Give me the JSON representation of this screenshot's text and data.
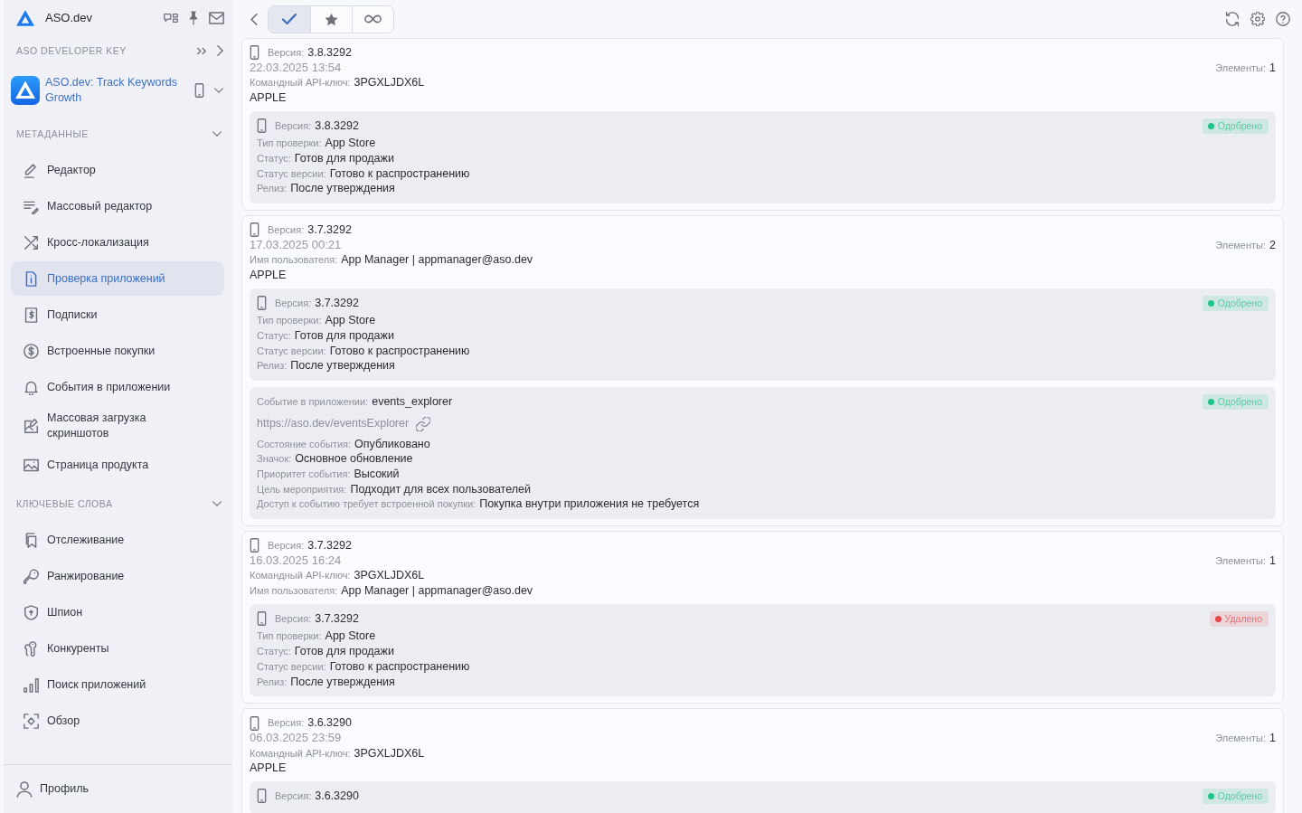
{
  "sidebar": {
    "brand": "ASO.dev",
    "developer_key": {
      "title": "ASO DEVELOPER KEY"
    },
    "app": {
      "name": "ASO.dev: Track Keywords Growth"
    },
    "sections": [
      {
        "title": "МЕТАДАННЫЕ",
        "expanded": true,
        "items": [
          {
            "label": "Редактор",
            "selected": false
          },
          {
            "label": "Массовый редактор",
            "selected": false
          },
          {
            "label": "Кросс-локализация",
            "selected": false
          },
          {
            "label": "Проверка приложений",
            "selected": true
          },
          {
            "label": "Подписки",
            "selected": false
          },
          {
            "label": "Встроенные покупки",
            "selected": false
          },
          {
            "label": "События в приложении",
            "selected": false
          },
          {
            "label": "Массовая загрузка скриншотов",
            "selected": false
          },
          {
            "label": "Страница продукта",
            "selected": false
          }
        ]
      },
      {
        "title": "КЛЮЧЕВЫЕ СЛОВА",
        "expanded": true,
        "items": [
          {
            "label": "Отслеживание",
            "selected": false
          },
          {
            "label": "Ранжирование",
            "selected": false
          },
          {
            "label": "Шпион",
            "selected": false
          },
          {
            "label": "Конкуренты",
            "selected": false
          },
          {
            "label": "Поиск приложений",
            "selected": false
          },
          {
            "label": "Обзор",
            "selected": false
          }
        ]
      }
    ],
    "profile": {
      "label": "Профиль"
    }
  },
  "toolbar": {
    "filters": [
      {
        "selected": true
      },
      {
        "selected": false
      },
      {
        "selected": false
      }
    ]
  },
  "submissions": [
    {
      "fields": [
        {
          "kind": "version",
          "label": "Версия:",
          "value": "3.8.3292"
        },
        {
          "kind": "date",
          "value": "22.03.2025 13:54"
        },
        {
          "kind": "field",
          "label": "Командный API-ключ:",
          "value": "3PGXLJDX6L"
        },
        {
          "kind": "plain",
          "value": "APPLE"
        }
      ],
      "count_label": "Элементы:",
      "count": "1",
      "items": [
        {
          "status": "Одобрено",
          "color": "#1fc48a",
          "fields": [
            {
              "kind": "version",
              "label": "Версия:",
              "value": "3.8.3292"
            },
            {
              "kind": "field",
              "label": "Тип проверки:",
              "value": "App Store"
            },
            {
              "kind": "field",
              "label": "Статус:",
              "value": "Готов для продажи"
            },
            {
              "kind": "field",
              "label": "Статус версии:",
              "value": "Готово к распространению"
            },
            {
              "kind": "field",
              "label": "Релиз:",
              "value": "После утверждения"
            }
          ]
        }
      ]
    },
    {
      "fields": [
        {
          "kind": "version",
          "label": "Версия:",
          "value": "3.7.3292"
        },
        {
          "kind": "date",
          "value": "17.03.2025 00:21"
        },
        {
          "kind": "field",
          "label": "Имя пользователя:",
          "value": "App Manager | appmanager@aso.dev"
        },
        {
          "kind": "plain",
          "value": "APPLE"
        }
      ],
      "count_label": "Элементы:",
      "count": "2",
      "items": [
        {
          "status": "Одобрено",
          "color": "#1fc48a",
          "fields": [
            {
              "kind": "version",
              "label": "Версия:",
              "value": "3.7.3292"
            },
            {
              "kind": "field",
              "label": "Тип проверки:",
              "value": "App Store"
            },
            {
              "kind": "field",
              "label": "Статус:",
              "value": "Готов для продажи"
            },
            {
              "kind": "field",
              "label": "Статус версии:",
              "value": "Готово к распространению"
            },
            {
              "kind": "field",
              "label": "Релиз:",
              "value": "После утверждения"
            }
          ]
        },
        {
          "status": "Одобрено",
          "color": "#1fc48a",
          "fields": [
            {
              "kind": "field",
              "label": "Событие в приложении:",
              "value": "events_explorer"
            },
            {
              "kind": "link",
              "value": "https://aso.dev/eventsExplorer"
            },
            {
              "kind": "field",
              "label": "Состояние события:",
              "value": "Опубликовано"
            },
            {
              "kind": "field",
              "label": "Значок:",
              "value": "Основное обновление"
            },
            {
              "kind": "field",
              "label": "Приоритет события:",
              "value": "Высокий"
            },
            {
              "kind": "field",
              "label": "Цель мероприятия:",
              "value": "Подходит для всех пользователей"
            },
            {
              "kind": "field",
              "label": "Доступ к событию требует встроенной покупки:",
              "value": "Покупка внутри приложения не требуется"
            }
          ]
        }
      ]
    },
    {
      "fields": [
        {
          "kind": "version",
          "label": "Версия:",
          "value": "3.7.3292"
        },
        {
          "kind": "date",
          "value": "16.03.2025 16:24"
        },
        {
          "kind": "field",
          "label": "Командный API-ключ:",
          "value": "3PGXLJDX6L"
        },
        {
          "kind": "field",
          "label": "Имя пользователя:",
          "value": "App Manager | appmanager@aso.dev"
        }
      ],
      "count_label": "Элементы:",
      "count": "1",
      "items": [
        {
          "status": "Удалено",
          "color": "#e5484d",
          "fields": [
            {
              "kind": "version",
              "label": "Версия:",
              "value": "3.7.3292"
            },
            {
              "kind": "field",
              "label": "Тип проверки:",
              "value": "App Store"
            },
            {
              "kind": "field",
              "label": "Статус:",
              "value": "Готов для продажи"
            },
            {
              "kind": "field",
              "label": "Статус версии:",
              "value": "Готово к распространению"
            },
            {
              "kind": "field",
              "label": "Релиз:",
              "value": "После утверждения"
            }
          ]
        }
      ]
    },
    {
      "fields": [
        {
          "kind": "version",
          "label": "Версия:",
          "value": "3.6.3290"
        },
        {
          "kind": "date",
          "value": "06.03.2025 23:59"
        },
        {
          "kind": "field",
          "label": "Командный API-ключ:",
          "value": "3PGXLJDX6L"
        },
        {
          "kind": "plain",
          "value": "APPLE"
        }
      ],
      "count_label": "Элементы:",
      "count": "1",
      "items": [
        {
          "status": "Одобрено",
          "color": "#1fc48a",
          "fields": [
            {
              "kind": "version",
              "label": "Версия:",
              "value": "3.6.3290"
            }
          ]
        }
      ]
    }
  ]
}
